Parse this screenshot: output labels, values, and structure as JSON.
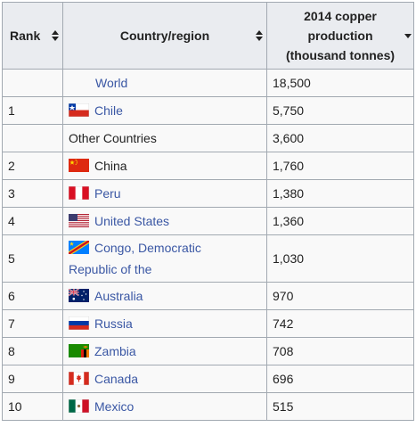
{
  "table": {
    "headers": {
      "rank": "Rank",
      "country": "Country/region",
      "production_line1": "2014 copper",
      "production_line2": "production",
      "production_line3": "(thousand tonnes)"
    },
    "rows": [
      {
        "rank": "",
        "country": "World",
        "production": "18,500",
        "flag": "none",
        "linked": true
      },
      {
        "rank": "1",
        "country": "Chile",
        "production": "5,750",
        "flag": "chile-flag-icon",
        "linked": true
      },
      {
        "rank": "",
        "country": "Other Countries",
        "production": "3,600",
        "flag": "none",
        "linked": false
      },
      {
        "rank": "2",
        "country": "China",
        "production": "1,760",
        "flag": "china-flag-icon",
        "linked": false
      },
      {
        "rank": "3",
        "country": "Peru",
        "production": "1,380",
        "flag": "peru-flag-icon",
        "linked": true
      },
      {
        "rank": "4",
        "country": "United States",
        "production": "1,360",
        "flag": "usa-flag-icon",
        "linked": true
      },
      {
        "rank": "5",
        "country_line1": "Congo, Democratic",
        "country_line2": "Republic of the",
        "production": "1,030",
        "flag": "drc-flag-icon",
        "linked": true
      },
      {
        "rank": "6",
        "country": "Australia",
        "production": "970",
        "flag": "australia-flag-icon",
        "linked": true
      },
      {
        "rank": "7",
        "country": "Russia",
        "production": "742",
        "flag": "russia-flag-icon",
        "linked": true
      },
      {
        "rank": "8",
        "country": "Zambia",
        "production": "708",
        "flag": "zambia-flag-icon",
        "linked": true
      },
      {
        "rank": "9",
        "country": "Canada",
        "production": "696",
        "flag": "canada-flag-icon",
        "linked": true
      },
      {
        "rank": "10",
        "country": "Mexico",
        "production": "515",
        "flag": "mexico-flag-icon",
        "linked": true
      }
    ]
  },
  "colors": {
    "link": "#3a57a4",
    "header_bg": "#eaecf0",
    "row_bg": "#f9f9f9",
    "border": "#a2a9b1"
  }
}
